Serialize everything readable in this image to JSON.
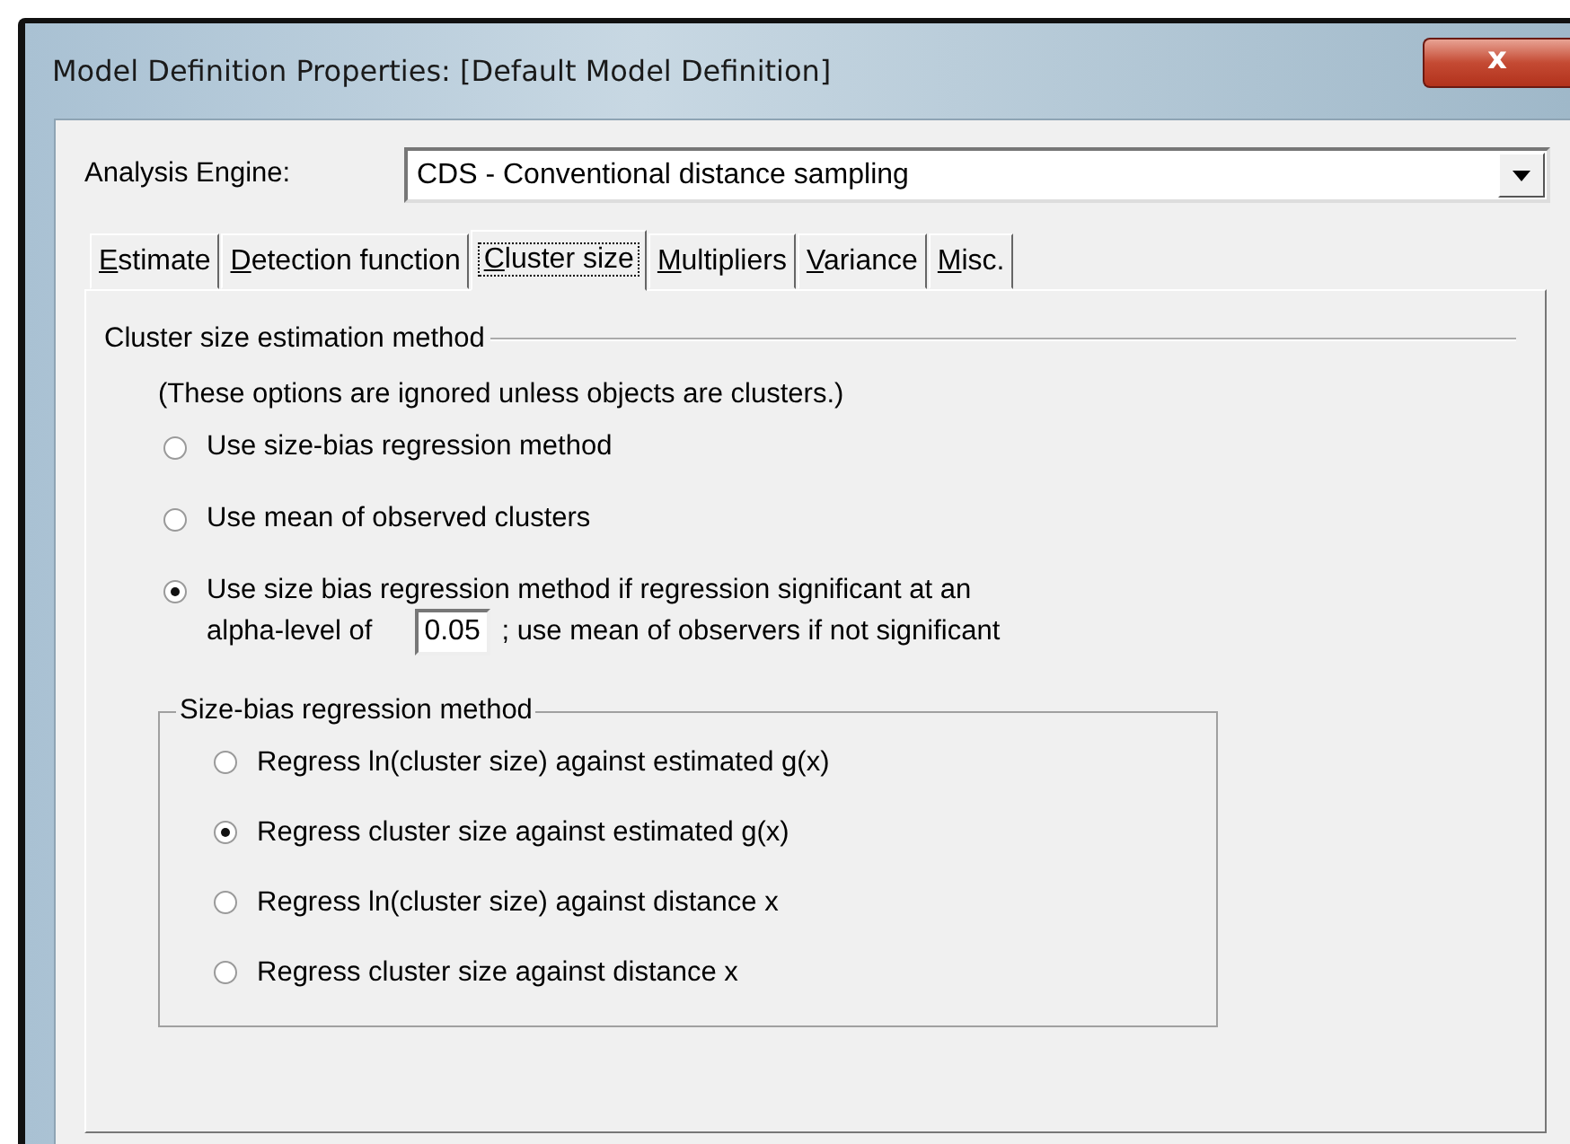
{
  "window": {
    "title": "Model Definition Properties: [Default Model Definition]",
    "close_symbol": "x"
  },
  "analysis_engine": {
    "label": "Analysis Engine:",
    "value": "CDS - Conventional distance sampling"
  },
  "tabs": [
    {
      "label": "Estimate",
      "selected": false
    },
    {
      "label": "Detection function",
      "selected": false
    },
    {
      "label": "Cluster size",
      "selected": true
    },
    {
      "label": "Multipliers",
      "selected": false
    },
    {
      "label": "Variance",
      "selected": false
    },
    {
      "label": "Misc.",
      "selected": false
    }
  ],
  "estimation_group": {
    "title": "Cluster size estimation method",
    "note": "(These options are ignored unless objects are clusters.)",
    "options": [
      {
        "label": "Use size-bias regression method",
        "selected": false
      },
      {
        "label": "Use mean of observed clusters",
        "selected": false
      },
      {
        "label": "Use size bias regression method if regression significant at an",
        "selected": true,
        "alpha_prefix": "alpha-level of",
        "alpha_value": "0.05",
        "alpha_suffix": "; use mean of observers if not significant"
      }
    ]
  },
  "regression_group": {
    "title": "Size-bias regression method",
    "options": [
      {
        "label": "Regress ln(cluster size) against estimated g(x)",
        "selected": false
      },
      {
        "label": "Regress cluster size against estimated g(x)",
        "selected": true
      },
      {
        "label": "Regress ln(cluster size) against distance x",
        "selected": false
      },
      {
        "label": "Regress cluster size against distance x",
        "selected": false
      }
    ]
  }
}
